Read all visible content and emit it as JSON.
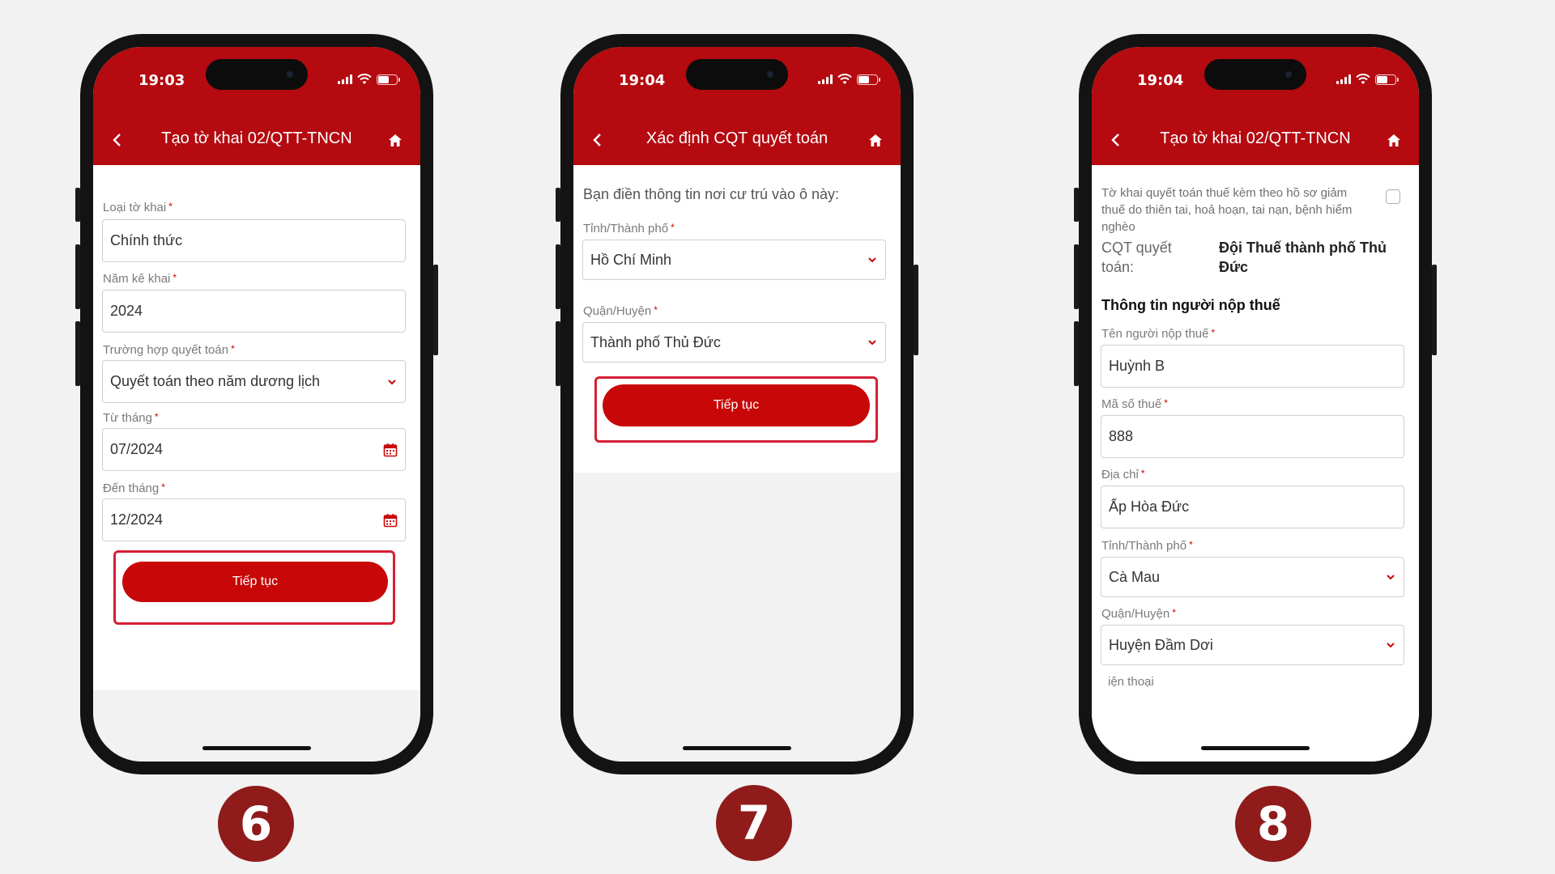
{
  "colors": {
    "brand": "#b40a10",
    "button": "#c80808",
    "highlight": "#d51f35",
    "step_badge": "#8f1b1b"
  },
  "icons": {
    "back": "chevron-left-icon",
    "home": "home-icon",
    "dropdown": "chevron-down-icon",
    "calendar": "calendar-icon"
  },
  "phones": [
    {
      "time": "19:03",
      "title": "Tạo tờ khai 02/QTT-TNCN",
      "fields": [
        {
          "label": "Loại tờ khai",
          "required": "*",
          "value": "Chính thức"
        },
        {
          "label": "Năm kê khai",
          "required": "*",
          "value": "2024"
        },
        {
          "label": "Trường hợp quyết toán",
          "required": "*",
          "value": "Quyết toán theo năm dương lịch"
        },
        {
          "label": "Từ tháng",
          "required": "*",
          "value": "07/2024"
        },
        {
          "label": "Đến tháng",
          "required": "*",
          "value": "12/2024"
        }
      ],
      "button": "Tiếp tục",
      "step": "6"
    },
    {
      "time": "19:04",
      "title": "Xác định CQT quyết toán",
      "intro": "Bạn điền thông tin nơi cư trú vào ô này:",
      "fields": [
        {
          "label": "Tỉnh/Thành phố",
          "required": "*",
          "value": "Hồ Chí Minh"
        },
        {
          "label": "Quận/Huyện",
          "required": "*",
          "value": "Thành phố Thủ Đức"
        }
      ],
      "button": "Tiếp tục",
      "step": "7"
    },
    {
      "time": "19:04",
      "title": "Tạo tờ khai 02/QTT-TNCN",
      "note": "Tờ khai quyết toán thuế kèm theo hồ sơ giảm thuế do thiên tai, hoả hoạn, tai nạn, bệnh hiểm nghèo",
      "cqt_label": "CQT quyết toán:",
      "cqt_value": "Đội Thuế thành phố Thủ Đức",
      "section": "Thông tin người nộp thuế",
      "fields": [
        {
          "label": "Tên người nộp thuế",
          "required": "*",
          "value": "Huỳnh B"
        },
        {
          "label": "Mã số thuế",
          "required": "*",
          "value": "888"
        },
        {
          "label": "Địa chỉ",
          "required": "*",
          "value": "Ấp Hòa Đức"
        },
        {
          "label": "Tỉnh/Thành phố",
          "required": "*",
          "value": "Cà Mau"
        },
        {
          "label": "Quận/Huyện",
          "required": "*",
          "value": "Huyện Đầm Dơi"
        }
      ],
      "partial_label": "iện thoại",
      "step": "8"
    }
  ]
}
